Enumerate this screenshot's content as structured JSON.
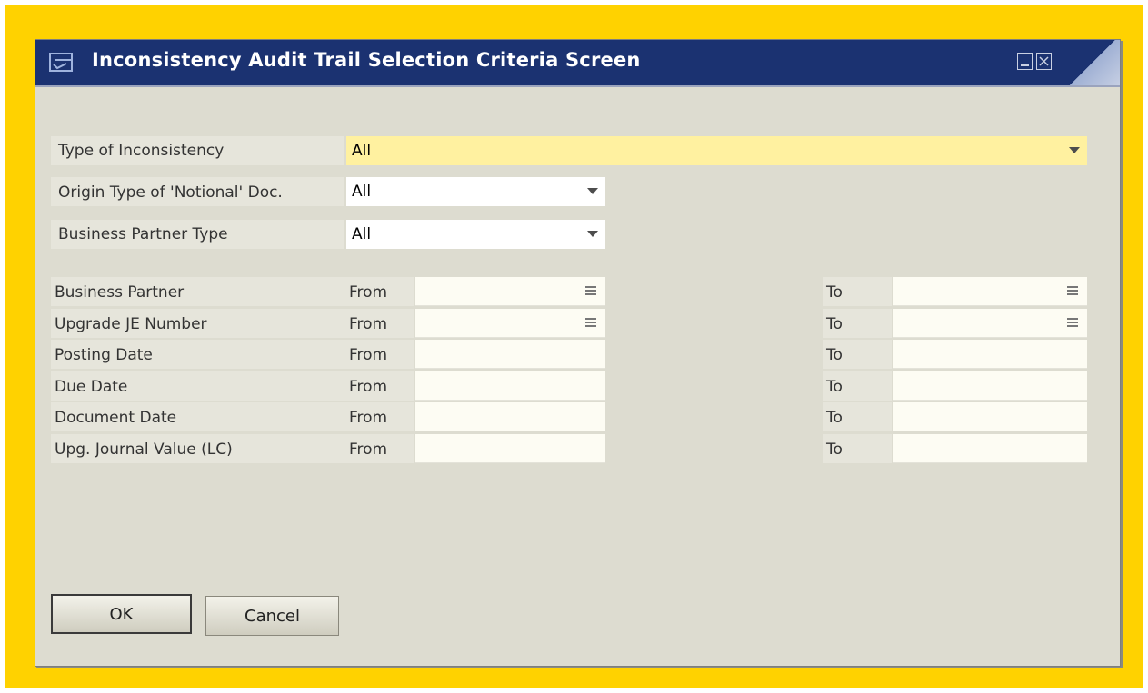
{
  "window": {
    "title": "Inconsistency Audit Trail Selection Criteria Screen"
  },
  "dropdowns": [
    {
      "label": "Type of Inconsistency",
      "value": "All"
    },
    {
      "label": "Origin Type of 'Notional' Doc.",
      "value": "All"
    },
    {
      "label": "Business Partner Type",
      "value": "All"
    }
  ],
  "range_labels": {
    "from": "From",
    "to": "To"
  },
  "ranges": [
    {
      "label": "Business Partner",
      "from_value": "",
      "to_value": "",
      "has_list_button": true
    },
    {
      "label": "Upgrade JE Number",
      "from_value": "",
      "to_value": "",
      "has_list_button": true
    },
    {
      "label": "Posting Date",
      "from_value": "",
      "to_value": "",
      "has_list_button": false
    },
    {
      "label": "Due Date",
      "from_value": "",
      "to_value": "",
      "has_list_button": false
    },
    {
      "label": "Document Date",
      "from_value": "",
      "to_value": "",
      "has_list_button": false
    },
    {
      "label": "Upg. Journal Value (LC)",
      "from_value": "",
      "to_value": "",
      "has_list_button": false
    }
  ],
  "buttons": {
    "ok": "OK",
    "cancel": "Cancel"
  },
  "colors": {
    "frame": "#ffd200",
    "titlebar": "#1b3271",
    "window_bg": "#dddcd0",
    "highlight_field": "#fff1a0"
  },
  "icons": {
    "title": "form-icon",
    "minimize": "minimize-icon",
    "close": "close-icon",
    "dropdown": "chevron-down-icon",
    "list": "list-icon"
  }
}
